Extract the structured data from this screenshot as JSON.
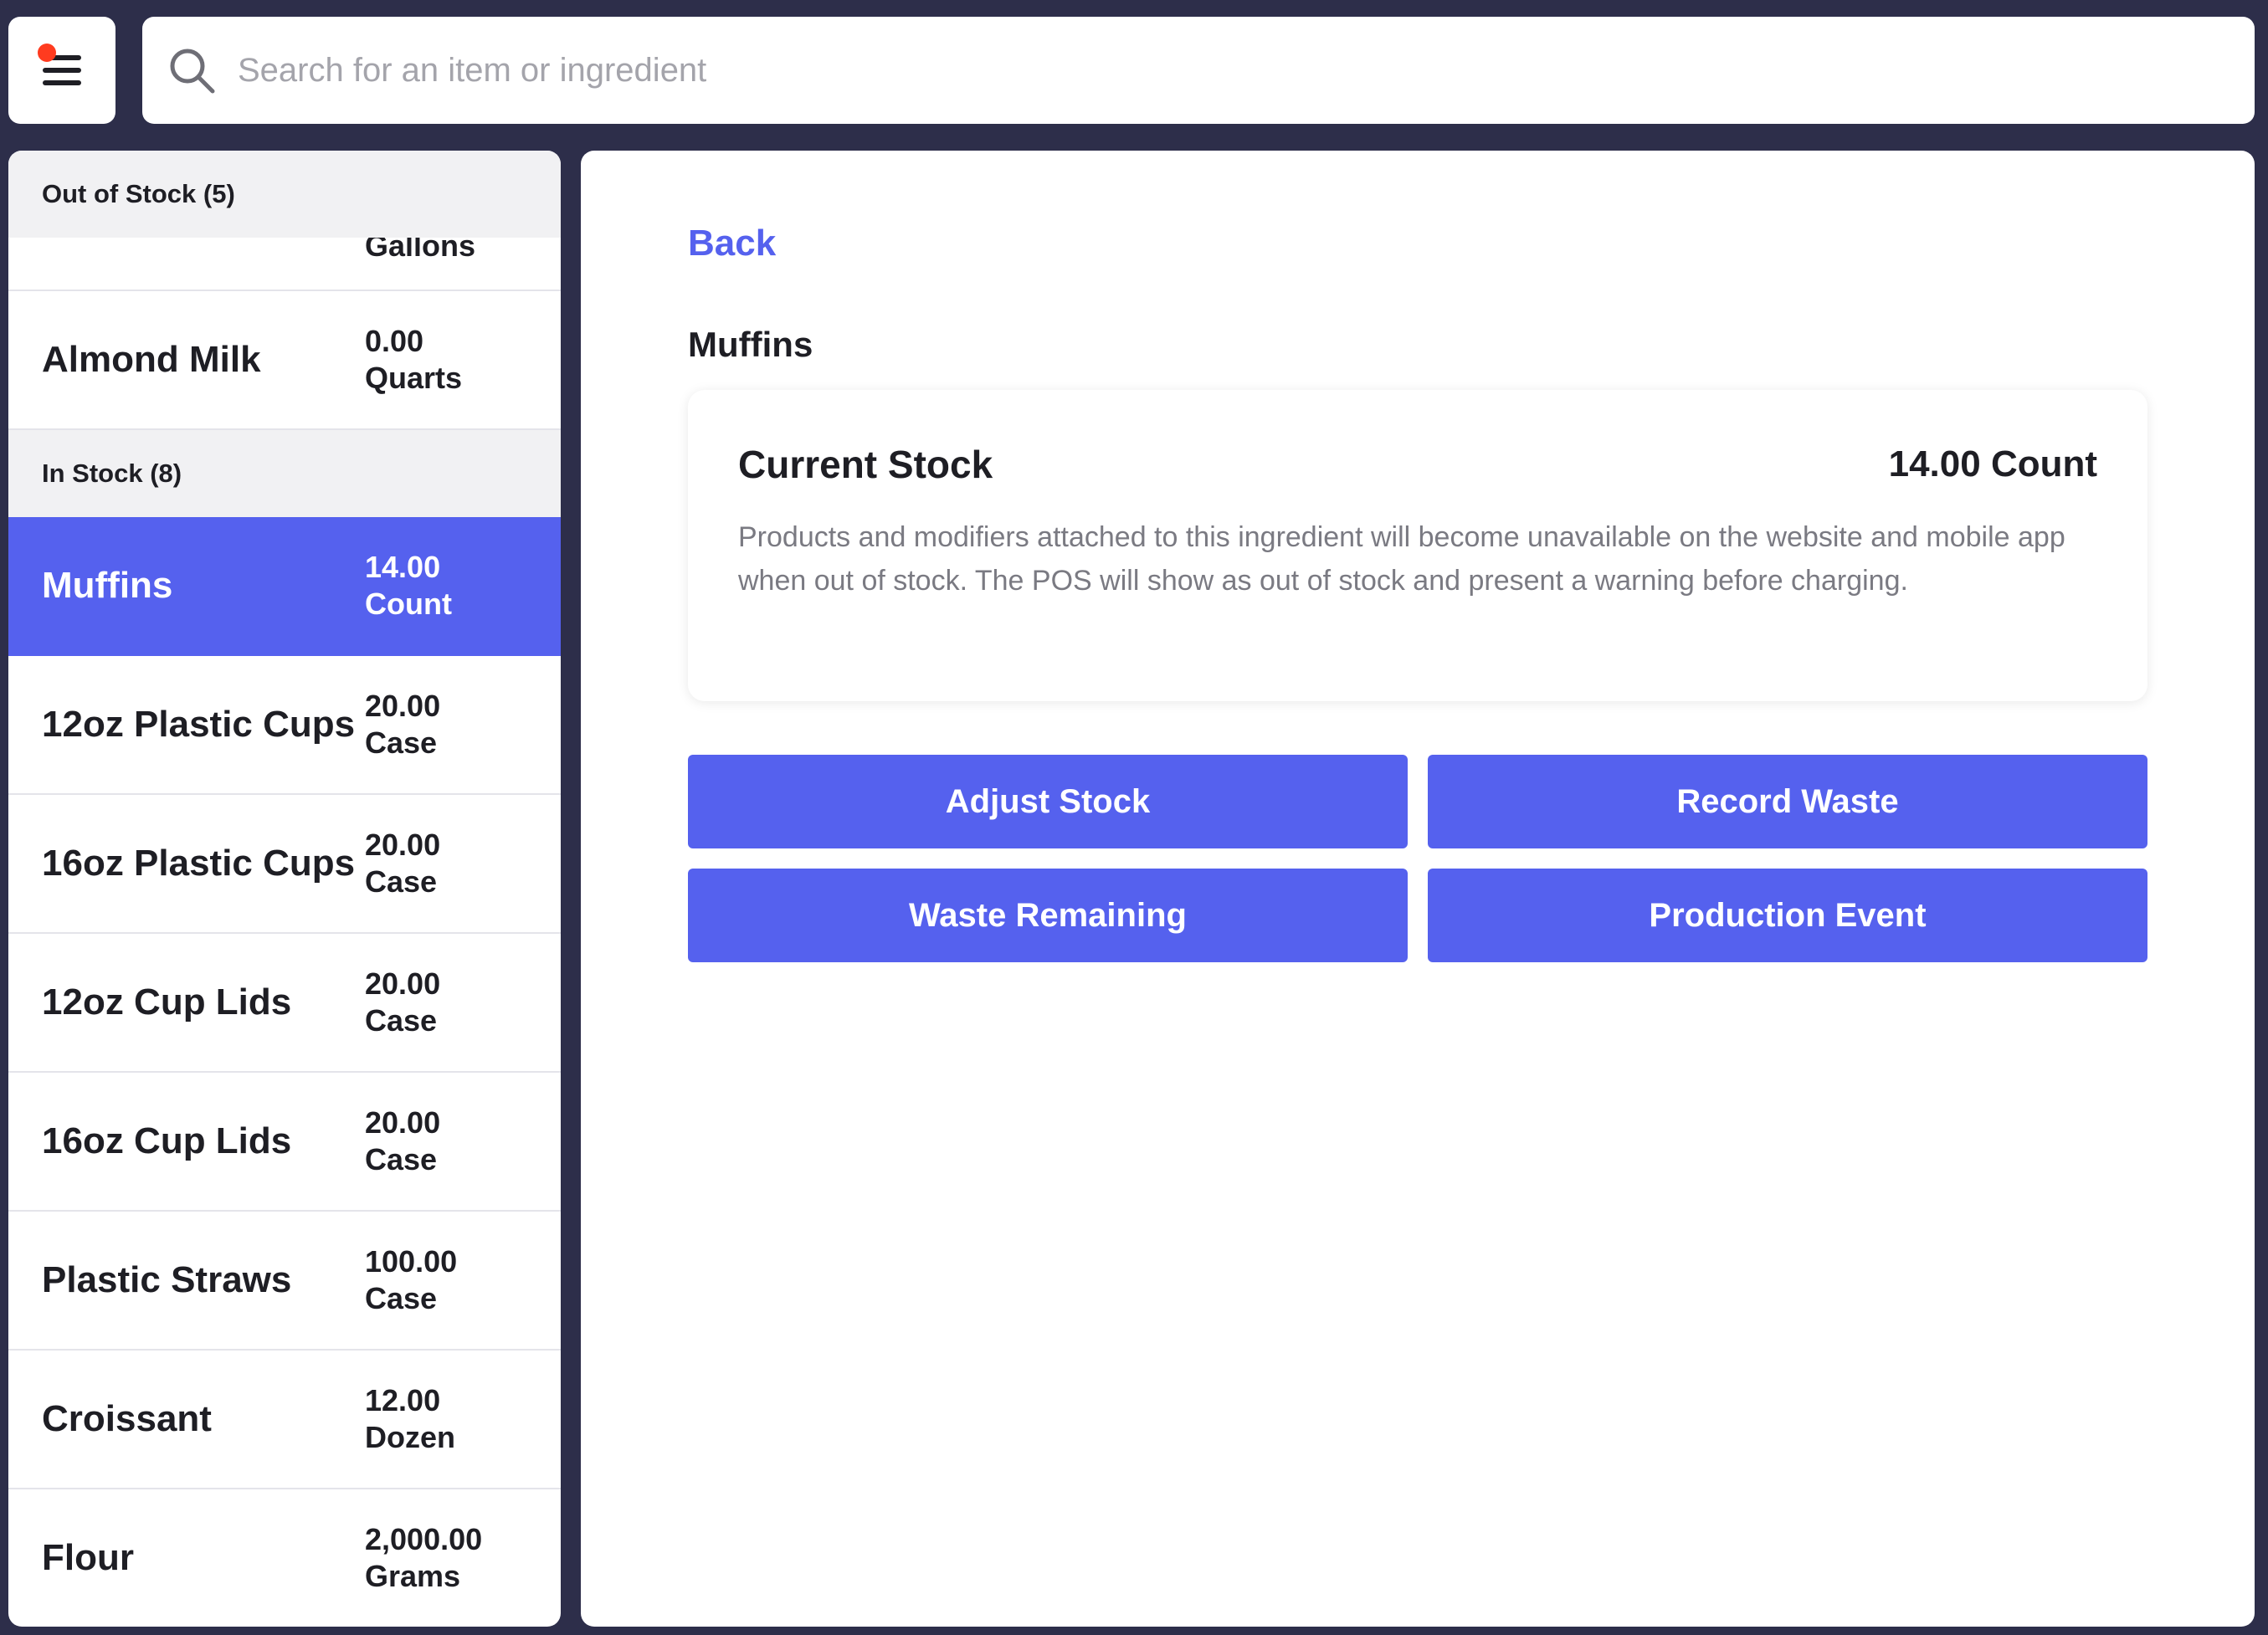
{
  "search": {
    "placeholder": "Search for an item or ingredient"
  },
  "sidebar": {
    "out_of_stock_header": "Out of Stock (5)",
    "partial_row_qty": "Gallons",
    "out_of_stock_items": [
      {
        "name": "Almond Milk",
        "qty": "0.00",
        "unit": "Quarts"
      }
    ],
    "in_stock_header": "In Stock (8)",
    "in_stock_items": [
      {
        "name": "Muffins",
        "qty": "14.00",
        "unit": "Count"
      },
      {
        "name": "12oz Plastic Cups",
        "qty": "20.00",
        "unit": "Case"
      },
      {
        "name": "16oz Plastic Cups",
        "qty": "20.00",
        "unit": "Case"
      },
      {
        "name": "12oz Cup Lids",
        "qty": "20.00",
        "unit": "Case"
      },
      {
        "name": "16oz Cup Lids",
        "qty": "20.00",
        "unit": "Case"
      },
      {
        "name": "Plastic Straws",
        "qty": "100.00",
        "unit": "Case"
      },
      {
        "name": "Croissant",
        "qty": "12.00",
        "unit": "Dozen"
      },
      {
        "name": "Flour",
        "qty": "2,000.00",
        "unit": "Grams"
      }
    ]
  },
  "detail": {
    "back_label": "Back",
    "title": "Muffins",
    "current_stock_label": "Current Stock",
    "current_stock_value": "14.00 Count",
    "description": "Products and modifiers attached to this ingredient will become unavailable on the website and mobile app when out of stock. The POS will show as out of stock and present a warning before charging.",
    "buttons": {
      "adjust_stock": "Adjust Stock",
      "record_waste": "Record Waste",
      "waste_remaining": "Waste Remaining",
      "production_event": "Production Event"
    }
  },
  "colors": {
    "accent": "#5561ee",
    "background": "#2d2e4a",
    "notification_dot": "#ff3b1f"
  }
}
